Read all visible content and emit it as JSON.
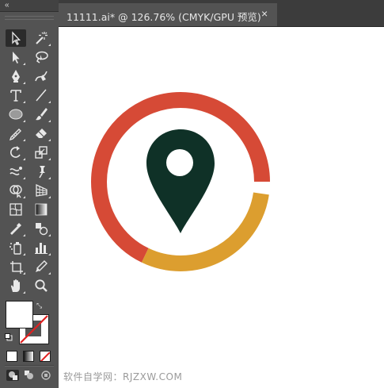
{
  "toolbar": {
    "collapse_glyph": "«",
    "tools": [
      {
        "name": "selection-tool",
        "icon": "selection-arrow-icon",
        "active": true
      },
      {
        "name": "magic-wand-tool",
        "icon": "magic-wand-icon"
      },
      {
        "name": "direct-selection-tool",
        "icon": "direct-selection-icon"
      },
      {
        "name": "lasso-tool",
        "icon": "lasso-icon"
      },
      {
        "name": "pen-tool",
        "icon": "pen-icon"
      },
      {
        "name": "curvature-tool",
        "icon": "curvature-icon"
      },
      {
        "name": "type-tool",
        "icon": "type-icon"
      },
      {
        "name": "line-segment-tool",
        "icon": "line-icon"
      },
      {
        "name": "ellipse-tool",
        "icon": "ellipse-icon"
      },
      {
        "name": "paintbrush-tool",
        "icon": "paintbrush-icon"
      },
      {
        "name": "pencil-tool",
        "icon": "pencil-icon"
      },
      {
        "name": "eraser-tool",
        "icon": "eraser-icon"
      },
      {
        "name": "rotate-tool",
        "icon": "rotate-icon"
      },
      {
        "name": "scale-tool",
        "icon": "scale-icon"
      },
      {
        "name": "warp-tool",
        "icon": "warp-icon"
      },
      {
        "name": "puppet-warp-tool",
        "icon": "pin-icon"
      },
      {
        "name": "shape-builder-tool",
        "icon": "shape-builder-icon"
      },
      {
        "name": "perspective-grid-tool",
        "icon": "perspective-grid-icon"
      },
      {
        "name": "mesh-tool",
        "icon": "mesh-icon"
      },
      {
        "name": "gradient-tool",
        "icon": "gradient-icon"
      },
      {
        "name": "eyedropper-tool",
        "icon": "eyedropper-icon"
      },
      {
        "name": "blend-tool",
        "icon": "blend-icon"
      },
      {
        "name": "symbol-sprayer-tool",
        "icon": "symbol-sprayer-icon"
      },
      {
        "name": "column-graph-tool",
        "icon": "bar-graph-icon"
      },
      {
        "name": "artboard-tool",
        "icon": "artboard-icon"
      },
      {
        "name": "slice-tool",
        "icon": "slice-icon"
      },
      {
        "name": "hand-tool",
        "icon": "hand-icon"
      },
      {
        "name": "zoom-tool",
        "icon": "zoom-icon"
      }
    ],
    "fill_color": "#ffffff",
    "stroke_color": "none"
  },
  "document_tab": {
    "title": "11111.ai* @ 126.76% (CMYK/GPU 预览)",
    "close_glyph": "×"
  },
  "artwork": {
    "ring_top_color": "#d64a36",
    "ring_bottom_color": "#dc9e2f",
    "pin_color": "#0f3127",
    "background": "#ffffff"
  },
  "watermark": "软件自学网：RJZXW.COM"
}
